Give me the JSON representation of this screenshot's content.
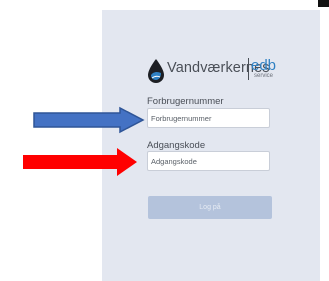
{
  "logo": {
    "word": "Vandværkernes",
    "mark": "edb",
    "sub": "service",
    "drop_icon": "water-drop-icon",
    "drop_color": "#2f80c2"
  },
  "form": {
    "consumer_number": {
      "label": "Forbrugernummer",
      "placeholder": "Forbrugernummer"
    },
    "password": {
      "label": "Adgangskode",
      "placeholder": "Adgangskode"
    },
    "login_button_label": "Log på"
  },
  "annotations": {
    "blue_arrow_color": "#4472c4",
    "red_arrow_color": "#ff0000"
  },
  "colors": {
    "panel_background": "#e3e7f0",
    "button_background": "#b4c3dc",
    "text": "#4a4f57"
  }
}
